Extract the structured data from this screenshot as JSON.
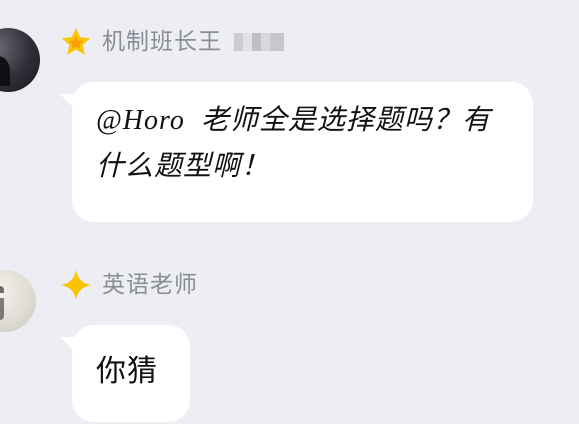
{
  "colors": {
    "background": "#eceef3",
    "bubble": "#ffffff",
    "name": "#8a8d96",
    "badge_star": "#f9c300"
  },
  "messages": [
    {
      "sender": "机制班长王",
      "sender_mosaic": true,
      "badge_icon": "star-badge",
      "text": "@Horo  老师全是选择题吗？有什么题型啊！"
    },
    {
      "sender": "英语老师",
      "badge_icon": "diamond-star-badge",
      "text": "你猜"
    }
  ]
}
